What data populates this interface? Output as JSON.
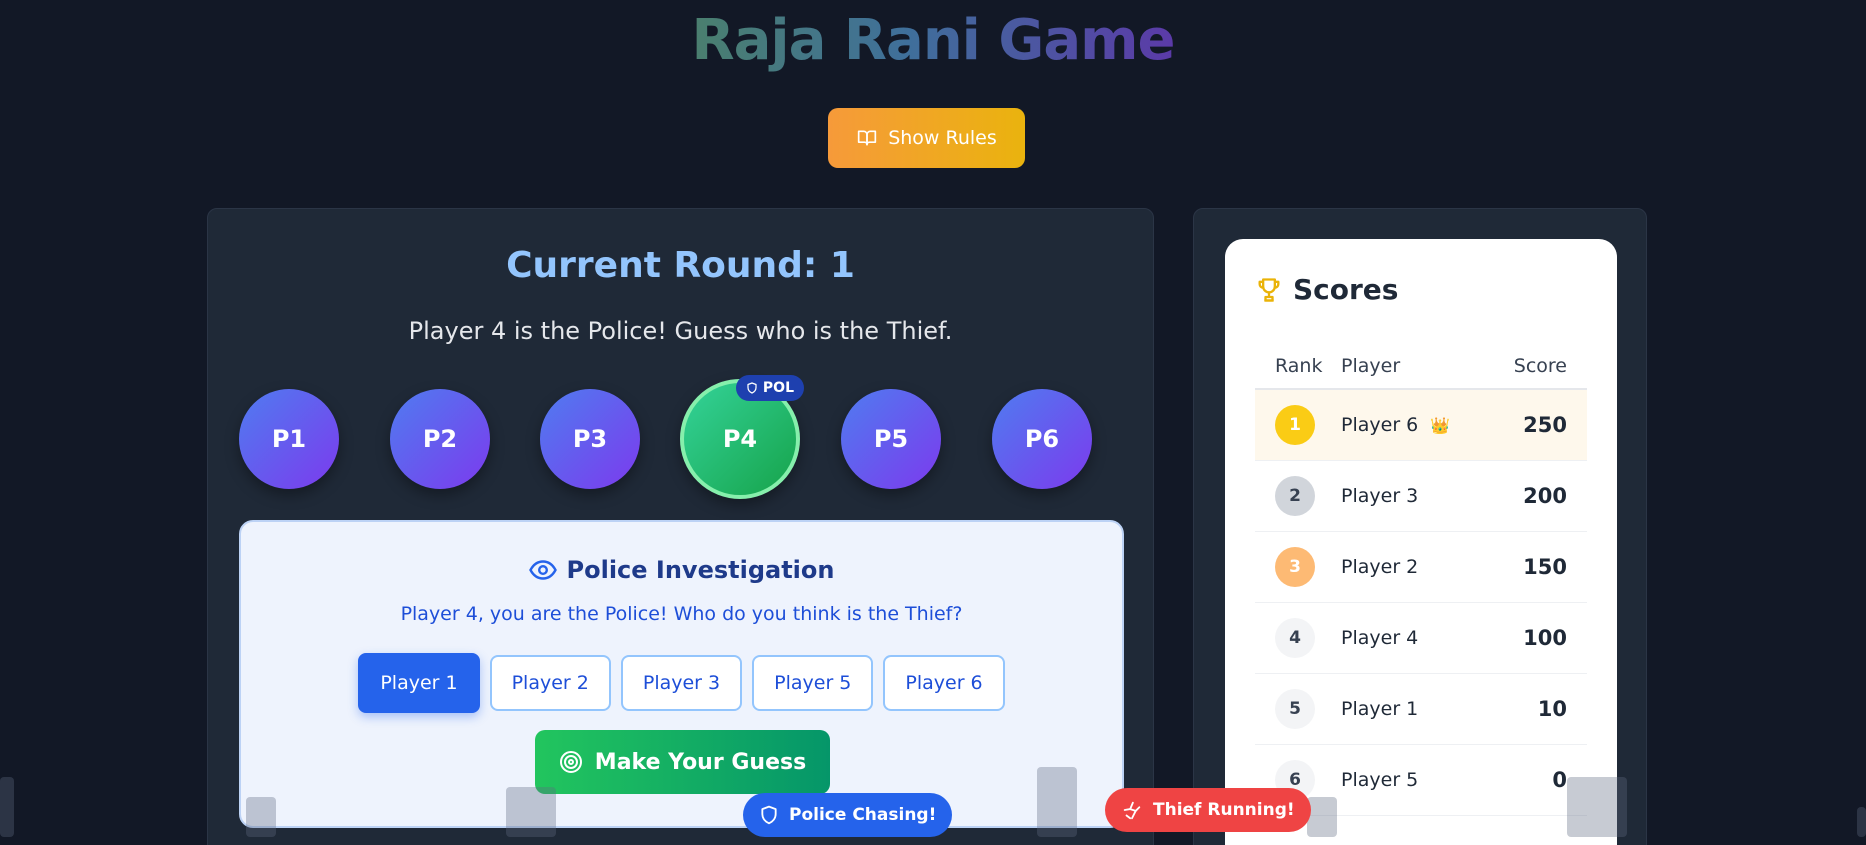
{
  "title": "Raja Rani Game",
  "rules_button": {
    "label": "Show Rules",
    "icon": "book-open-icon"
  },
  "round": {
    "title": "Current Round: 1",
    "message": "Player 4 is the Police! Guess who is the Thief."
  },
  "players": [
    {
      "label": "P1"
    },
    {
      "label": "P2"
    },
    {
      "label": "P3"
    },
    {
      "label": "P4",
      "role_badge": "POL"
    },
    {
      "label": "P5"
    },
    {
      "label": "P6"
    }
  ],
  "investigation": {
    "title": "Police Investigation",
    "icon": "eye-icon",
    "message": "Player 4, you are the Police! Who do you think is the Thief?",
    "choices": [
      "Player 1",
      "Player 2",
      "Player 3",
      "Player 5",
      "Player 6"
    ],
    "selected": "Player 1",
    "guess_button": "Make Your Guess"
  },
  "scores": {
    "title": "Scores",
    "icon": "trophy-icon",
    "columns": [
      "Rank",
      "Player",
      "Score"
    ],
    "rows": [
      {
        "rank": "1",
        "player": "Player 6",
        "score": "250",
        "crown": "👑"
      },
      {
        "rank": "2",
        "player": "Player 3",
        "score": "200"
      },
      {
        "rank": "3",
        "player": "Player 2",
        "score": "150"
      },
      {
        "rank": "4",
        "player": "Player 4",
        "score": "100"
      },
      {
        "rank": "5",
        "player": "Player 1",
        "score": "10"
      },
      {
        "rank": "6",
        "player": "Player 5",
        "score": "0"
      }
    ]
  },
  "animations": {
    "police_label": "Police Chasing!",
    "thief_label": "Thief Running!"
  },
  "colors": {
    "background": "#121826",
    "panel": "#1f2937",
    "accent_blue": "#2563eb",
    "police_green": "#22c55e",
    "thief_red": "#ef4444",
    "rules_orange": "#f69a3a"
  }
}
